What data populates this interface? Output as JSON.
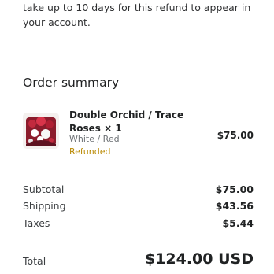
{
  "refund_note": "take up to 10 days for this refund to appear in your account.",
  "order_summary": {
    "title": "Order summary",
    "item": {
      "image_icon": "flower-arrangement-thumbnail",
      "name": "Double Orchid / Trace Roses × 1",
      "variant": "White / Red",
      "status": "Refunded",
      "status_color": "#b98900",
      "price": "$75.00"
    },
    "subtotal": {
      "label": "Subtotal",
      "value": "$75.00"
    },
    "shipping": {
      "label": "Shipping",
      "value": "$43.56"
    },
    "taxes": {
      "label": "Taxes",
      "value": "$5.44"
    },
    "total": {
      "label": "Total",
      "value": "$124.00 USD"
    }
  }
}
